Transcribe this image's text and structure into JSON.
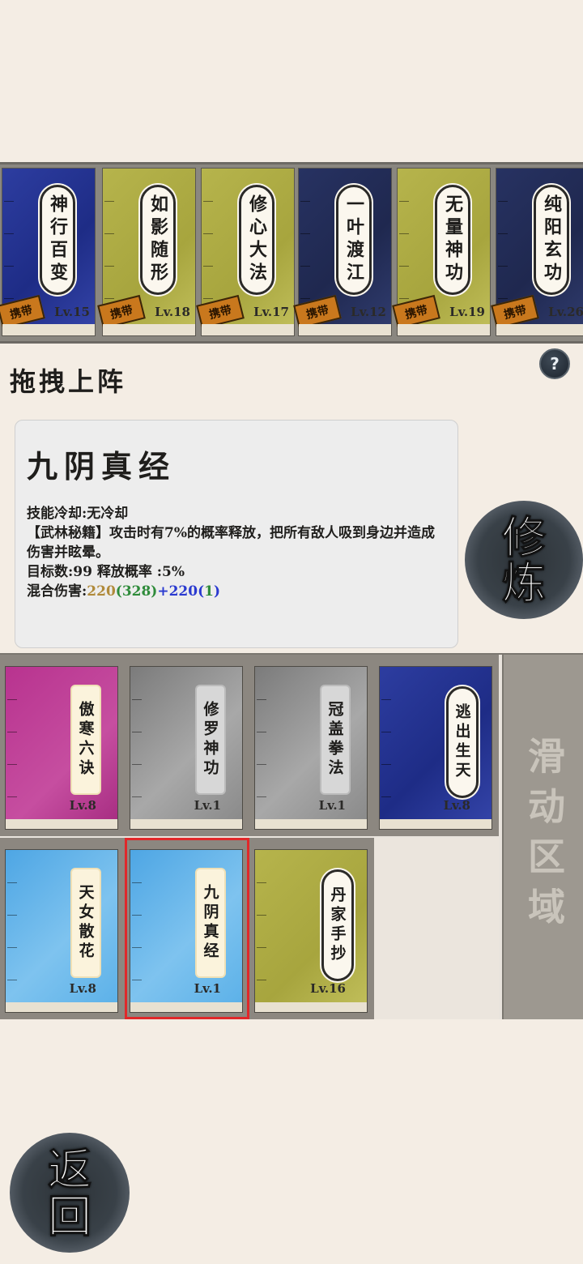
{
  "equipped_books": [
    {
      "name": "神行百变",
      "level": "Lv.15",
      "color": "blue",
      "carry": "携带"
    },
    {
      "name": "如影随形",
      "level": "Lv.18",
      "color": "olive",
      "carry": "携带"
    },
    {
      "name": "修心大法",
      "level": "Lv.17",
      "color": "olive",
      "carry": "携带"
    },
    {
      "name": "一叶渡江",
      "level": "Lv.12",
      "color": "navy",
      "carry": "携带"
    },
    {
      "name": "无量神功",
      "level": "Lv.19",
      "color": "olive",
      "carry": "携带"
    },
    {
      "name": "纯阳玄功",
      "level": "Lv.26",
      "color": "navy",
      "carry": "携带"
    }
  ],
  "drag_label": "拖拽上阵",
  "help_label": "?",
  "detail": {
    "name": "九阴真经",
    "cooldown": "技能冷却:无冷却",
    "description": "【武林秘籍】攻击时有7%的概率释放，把所有敌人吸到身边并造成伤害并眩晕。",
    "targets": "目标数:99  释放概率 :5%",
    "damage_label": "混合伤害:",
    "damage_a": "220",
    "damage_a_bonus": "(328)",
    "damage_plus": "+220",
    "damage_b_open": "(",
    "damage_b_bonus": "1",
    "damage_b_close": ")"
  },
  "cultivate_button": [
    "修",
    "炼"
  ],
  "library_books": [
    {
      "name": "傲寒六诀",
      "level": "Lv.8",
      "color": "pink"
    },
    {
      "name": "修罗神功",
      "level": "Lv.1",
      "color": "gray"
    },
    {
      "name": "冠盖拳法",
      "level": "Lv.1",
      "color": "gray"
    },
    {
      "name": "逃出生天",
      "level": "Lv.8",
      "color": "blue"
    },
    {
      "name": "天女散花",
      "level": "Lv.8",
      "color": "lightblue"
    },
    {
      "name": "九阴真经",
      "level": "Lv.1",
      "color": "lightblue",
      "selected": true
    },
    {
      "name": "丹家手抄",
      "level": "Lv.16",
      "color": "olive"
    }
  ],
  "scroll_zone_label": "滑动区域",
  "back_button": [
    "返",
    "回"
  ]
}
